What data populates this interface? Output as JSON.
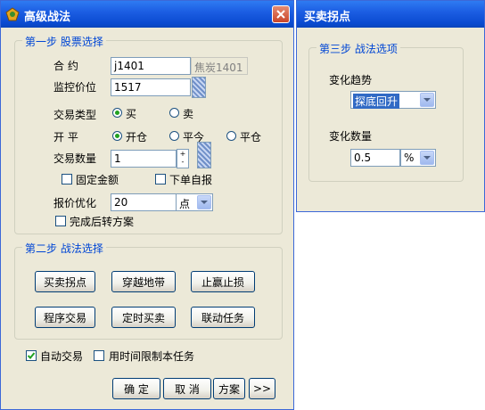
{
  "main_window": {
    "title": "高级战法",
    "step1": {
      "title": "第一步  股票选择",
      "contract_label": "合    约",
      "contract_value": "j1401",
      "contract_name": "焦炭1401",
      "monitor_price_label": "监控价位",
      "monitor_price_value": "1517",
      "trade_type_label": "交易类型",
      "trade_type_options": [
        "买",
        "卖"
      ],
      "trade_type_selected": "买",
      "open_close_label": "开    平",
      "open_close_options": [
        "开仓",
        "平今",
        "平仓"
      ],
      "open_close_selected": "开仓",
      "quantity_label": "交易数量",
      "quantity_value": "1",
      "fixed_amount_label": "固定金额",
      "fixed_amount_checked": false,
      "auto_order_label": "下单自报",
      "auto_order_checked": false,
      "price_opt_label": "报价优化",
      "price_opt_value": "20",
      "price_opt_unit": "点",
      "after_done_label": "完成后转方案",
      "after_done_checked": false
    },
    "step2": {
      "title": "第二步  战法选择",
      "buttons": [
        "买卖拐点",
        "穿越地带",
        "止赢止损",
        "程序交易",
        "定时买卖",
        "联动任务"
      ]
    },
    "auto_trade_label": "自动交易",
    "auto_trade_checked": true,
    "time_limit_label": "用时间限制本任务",
    "time_limit_checked": false,
    "footer_buttons": {
      "ok": "确  定",
      "cancel": "取  消",
      "plan": "方案",
      "more": ">>"
    }
  },
  "side_window": {
    "title": "买卖拐点",
    "step3": {
      "title": "第三步  战法选项",
      "trend_label": "变化趋势",
      "trend_value": "探底回升",
      "amount_label": "变化数量",
      "amount_value": "0.5",
      "amount_unit": "%"
    }
  },
  "colors": {
    "titlebar": "#0a4ad0",
    "window_bg": "#ece9d8",
    "group_title": "#0046d5",
    "check_mark": "#21a121"
  }
}
